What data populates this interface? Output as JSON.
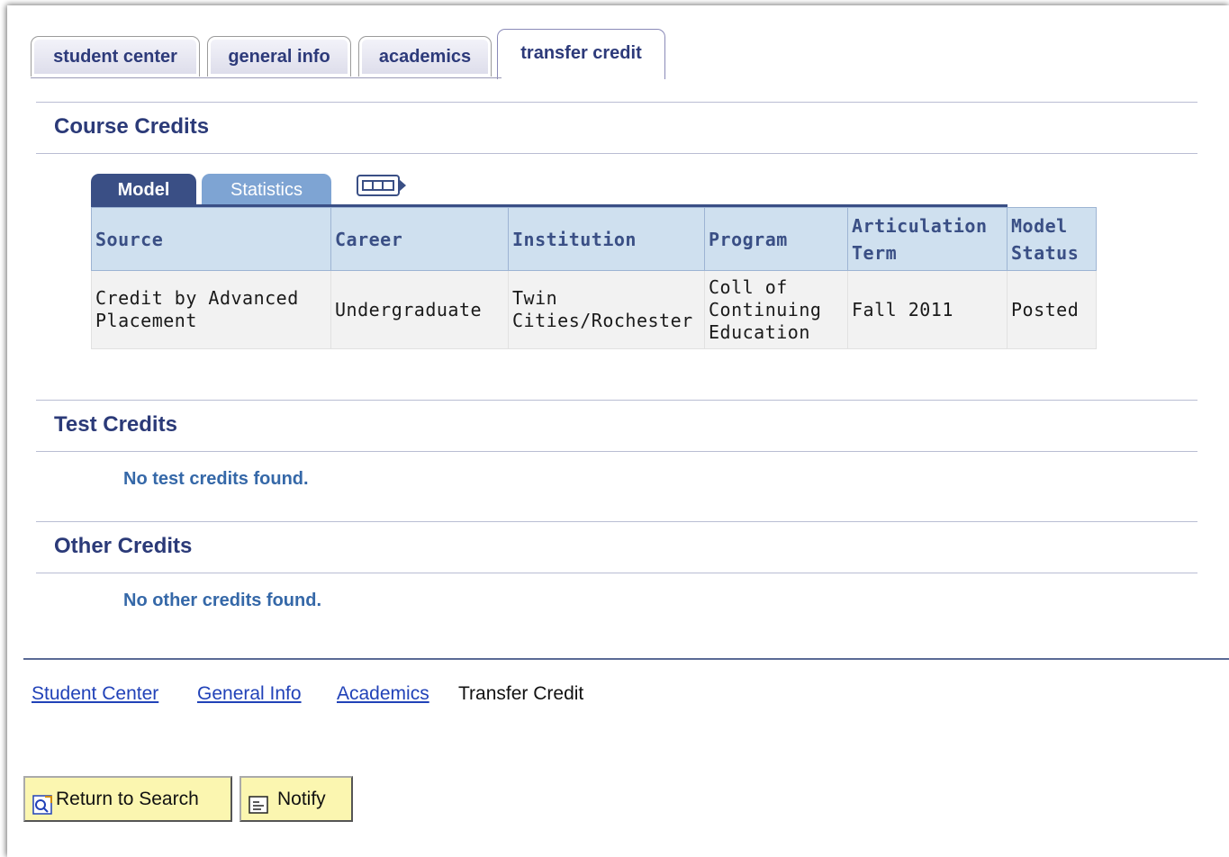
{
  "tabs": [
    {
      "label": "student center"
    },
    {
      "label": "general info"
    },
    {
      "label": "academics"
    },
    {
      "label": "transfer credit",
      "active": true
    }
  ],
  "course_credits": {
    "title": "Course Credits",
    "grid_tabs": [
      {
        "label": "Model",
        "active": true
      },
      {
        "label": "Statistics"
      }
    ],
    "show_all_columns_icon": "show-all-columns-icon",
    "columns": [
      "Source",
      "Career",
      "Institution",
      "Program",
      "Articulation Term",
      "Model Status"
    ],
    "rows": [
      {
        "source": "Credit by Advanced Placement",
        "career": "Undergraduate",
        "institution": "Twin Cities/Rochester",
        "program": "Coll of Continuing Education",
        "articulation_term": "Fall 2011",
        "model_status": "Posted"
      }
    ]
  },
  "test_credits": {
    "title": "Test Credits",
    "empty": "No test credits found."
  },
  "other_credits": {
    "title": "Other Credits",
    "empty": "No other credits found."
  },
  "footer_links": [
    {
      "label": "Student Center"
    },
    {
      "label": "General Info"
    },
    {
      "label": "Academics"
    },
    {
      "label": "Transfer Credit",
      "current": true
    }
  ],
  "buttons": {
    "return_to_search": "Return to Search",
    "notify": "Notify"
  },
  "colors": {
    "heading": "#2b3a78",
    "link": "#2142b8",
    "grid_tab_active": "#3a4f85",
    "grid_tab_inactive": "#7ea4d3",
    "button_bg": "#fbf6b0"
  }
}
